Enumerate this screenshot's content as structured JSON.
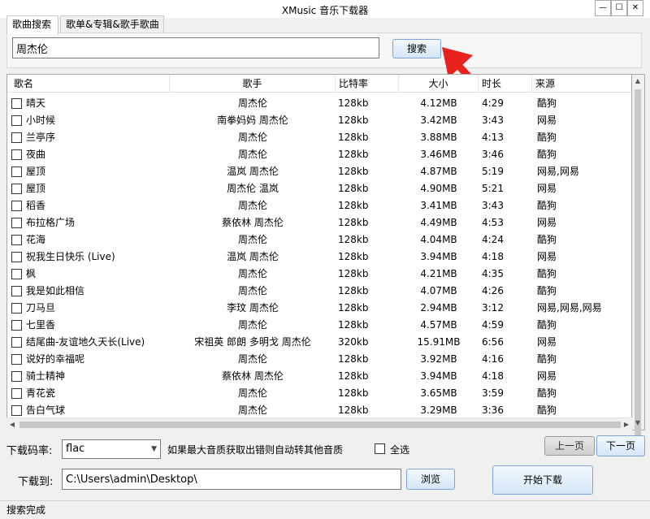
{
  "window": {
    "title": "XMusic 音乐下载器"
  },
  "tabs": [
    {
      "label": "歌曲搜索",
      "active": true
    },
    {
      "label": "歌单&专辑&歌手歌曲",
      "active": false
    }
  ],
  "search": {
    "value": "周杰伦",
    "button_label": "搜索"
  },
  "table": {
    "headers": {
      "name": "歌名",
      "artist": "歌手",
      "bitrate": "比特率",
      "size": "大小",
      "duration": "时长",
      "source": "来源"
    },
    "rows": [
      {
        "name": "晴天",
        "artist": "周杰伦",
        "bitrate": "128kb",
        "size": "4.12MB",
        "duration": "4:29",
        "source": "酷狗"
      },
      {
        "name": "小时候",
        "artist": "南拳妈妈 周杰伦",
        "bitrate": "128kb",
        "size": "3.42MB",
        "duration": "3:43",
        "source": "网易"
      },
      {
        "name": "兰亭序",
        "artist": "周杰伦",
        "bitrate": "128kb",
        "size": "3.88MB",
        "duration": "4:13",
        "source": "酷狗"
      },
      {
        "name": "夜曲",
        "artist": "周杰伦",
        "bitrate": "128kb",
        "size": "3.46MB",
        "duration": "3:46",
        "source": "酷狗"
      },
      {
        "name": "屋顶",
        "artist": "温岚 周杰伦",
        "bitrate": "128kb",
        "size": "4.87MB",
        "duration": "5:19",
        "source": "网易,网易"
      },
      {
        "name": "屋顶",
        "artist": "周杰伦 温岚",
        "bitrate": "128kb",
        "size": "4.90MB",
        "duration": "5:21",
        "source": "网易"
      },
      {
        "name": "稻香",
        "artist": "周杰伦",
        "bitrate": "128kb",
        "size": "3.41MB",
        "duration": "3:43",
        "source": "酷狗"
      },
      {
        "name": "布拉格广场",
        "artist": "蔡依林 周杰伦",
        "bitrate": "128kb",
        "size": "4.49MB",
        "duration": "4:53",
        "source": "网易"
      },
      {
        "name": "花海",
        "artist": "周杰伦",
        "bitrate": "128kb",
        "size": "4.04MB",
        "duration": "4:24",
        "source": "酷狗"
      },
      {
        "name": "祝我生日快乐 (Live)",
        "artist": "温岚 周杰伦",
        "bitrate": "128kb",
        "size": "3.94MB",
        "duration": "4:18",
        "source": "网易"
      },
      {
        "name": "枫",
        "artist": "周杰伦",
        "bitrate": "128kb",
        "size": "4.21MB",
        "duration": "4:35",
        "source": "酷狗"
      },
      {
        "name": "我是如此相信",
        "artist": "周杰伦",
        "bitrate": "128kb",
        "size": "4.07MB",
        "duration": "4:26",
        "source": "酷狗"
      },
      {
        "name": "刀马旦",
        "artist": "李玟 周杰伦",
        "bitrate": "128kb",
        "size": "2.94MB",
        "duration": "3:12",
        "source": "网易,网易,网易"
      },
      {
        "name": "七里香",
        "artist": "周杰伦",
        "bitrate": "128kb",
        "size": "4.57MB",
        "duration": "4:59",
        "source": "酷狗"
      },
      {
        "name": "结尾曲-友谊地久天长(Live)",
        "artist": "宋祖英 郎朗 多明戈 周杰伦",
        "bitrate": "320kb",
        "size": "15.91MB",
        "duration": "6:56",
        "source": "网易"
      },
      {
        "name": "说好的幸福呢",
        "artist": "周杰伦",
        "bitrate": "128kb",
        "size": "3.92MB",
        "duration": "4:16",
        "source": "酷狗"
      },
      {
        "name": "骑士精神",
        "artist": "蔡依林 周杰伦",
        "bitrate": "128kb",
        "size": "3.94MB",
        "duration": "4:18",
        "source": "网易"
      },
      {
        "name": "青花瓷",
        "artist": "周杰伦",
        "bitrate": "128kb",
        "size": "3.65MB",
        "duration": "3:59",
        "source": "酷狗"
      },
      {
        "name": "告白气球",
        "artist": "周杰伦",
        "bitrate": "128kb",
        "size": "3.29MB",
        "duration": "3:36",
        "source": "酷狗"
      }
    ]
  },
  "download": {
    "bitrate_label": "下载码率:",
    "bitrate_value": "flac",
    "fallback_note": "如果最大音质获取出错则自动转其他音质",
    "select_all_label": "全选",
    "prev_label": "上一页",
    "next_label": "下一页",
    "path_label": "下载到:",
    "path_value": "C:\\Users\\admin\\Desktop\\",
    "browse_label": "浏览",
    "start_label": "开始下载"
  },
  "status": {
    "text": "搜索完成"
  }
}
